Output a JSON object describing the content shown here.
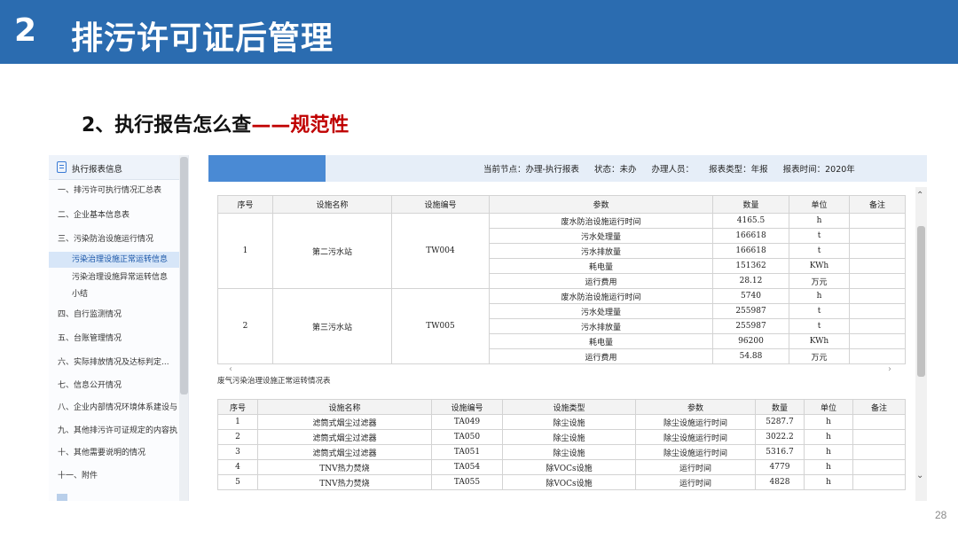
{
  "slide": {
    "number": "2",
    "title": "排污许可证后管理",
    "subtitle": "2、执行报告怎么查",
    "subtitle_dash": "——",
    "subtitle_accent": "规范性",
    "page": "28",
    "colors": {
      "title_bar": "#2b6cb0",
      "accent": "#c00000",
      "selection": "#d7e6f8"
    }
  },
  "sidebar": {
    "header_icon": "document-icon",
    "header": "执行报表信息",
    "items": [
      "一、排污许可执行情况汇总表",
      "二、企业基本信息表",
      "三、污染防治设施运行情况",
      "污染治理设施正常运转信息",
      "污染治理设施异常运转信息",
      "小结",
      "四、自行监测情况",
      "五、台账管理情况",
      "六、实际排放情况及达标判定...",
      "七、信息公开情况",
      "八、企业内部情况环境体系建设与",
      "九、其他排污许可证规定的内容执",
      "十、其他需要说明的情况",
      "十一、附件"
    ]
  },
  "status": {
    "node": "当前节点：办理-执行报表",
    "state": "状态：未办",
    "handler": "办理人员：",
    "report_type": "报表类型：年报",
    "report_time": "报表时间：2020年"
  },
  "table1": {
    "headers": [
      "序号",
      "设施名称",
      "设施编号",
      "参数",
      "数量",
      "单位",
      "备注"
    ],
    "groups": [
      {
        "seq": "1",
        "name": "第二污水站",
        "code": "TW004",
        "rows": [
          [
            "废水防治设施运行时间",
            "4165.5",
            "h"
          ],
          [
            "污水处理量",
            "166618",
            "t"
          ],
          [
            "污水排放量",
            "166618",
            "t"
          ],
          [
            "耗电量",
            "151362",
            "KWh"
          ],
          [
            "运行费用",
            "28.12",
            "万元"
          ]
        ]
      },
      {
        "seq": "2",
        "name": "第三污水站",
        "code": "TW005",
        "rows": [
          [
            "废水防治设施运行时间",
            "5740",
            "h"
          ],
          [
            "污水处理量",
            "255987",
            "t"
          ],
          [
            "污水排放量",
            "255987",
            "t"
          ],
          [
            "耗电量",
            "96200",
            "KWh"
          ],
          [
            "运行费用",
            "54.88",
            "万元"
          ]
        ]
      }
    ]
  },
  "table2": {
    "caption": "废气污染治理设施正常运转情况表",
    "headers": [
      "序号",
      "设施名称",
      "设施编号",
      "设施类型",
      "参数",
      "数量",
      "单位",
      "备注"
    ],
    "rows": [
      [
        "1",
        "滤筒式烟尘过滤器",
        "TA049",
        "除尘设施",
        "除尘设施运行时间",
        "5287.7",
        "h",
        ""
      ],
      [
        "2",
        "滤筒式烟尘过滤器",
        "TA050",
        "除尘设施",
        "除尘设施运行时间",
        "3022.2",
        "h",
        ""
      ],
      [
        "3",
        "滤筒式烟尘过滤器",
        "TA051",
        "除尘设施",
        "除尘设施运行时间",
        "5316.7",
        "h",
        ""
      ],
      [
        "4",
        "TNV热力焚烧",
        "TA054",
        "除VOCs设施",
        "运行时间",
        "4779",
        "h",
        ""
      ],
      [
        "5",
        "TNV热力焚烧",
        "TA055",
        "除VOCs设施",
        "运行时间",
        "4828",
        "h",
        ""
      ]
    ]
  }
}
